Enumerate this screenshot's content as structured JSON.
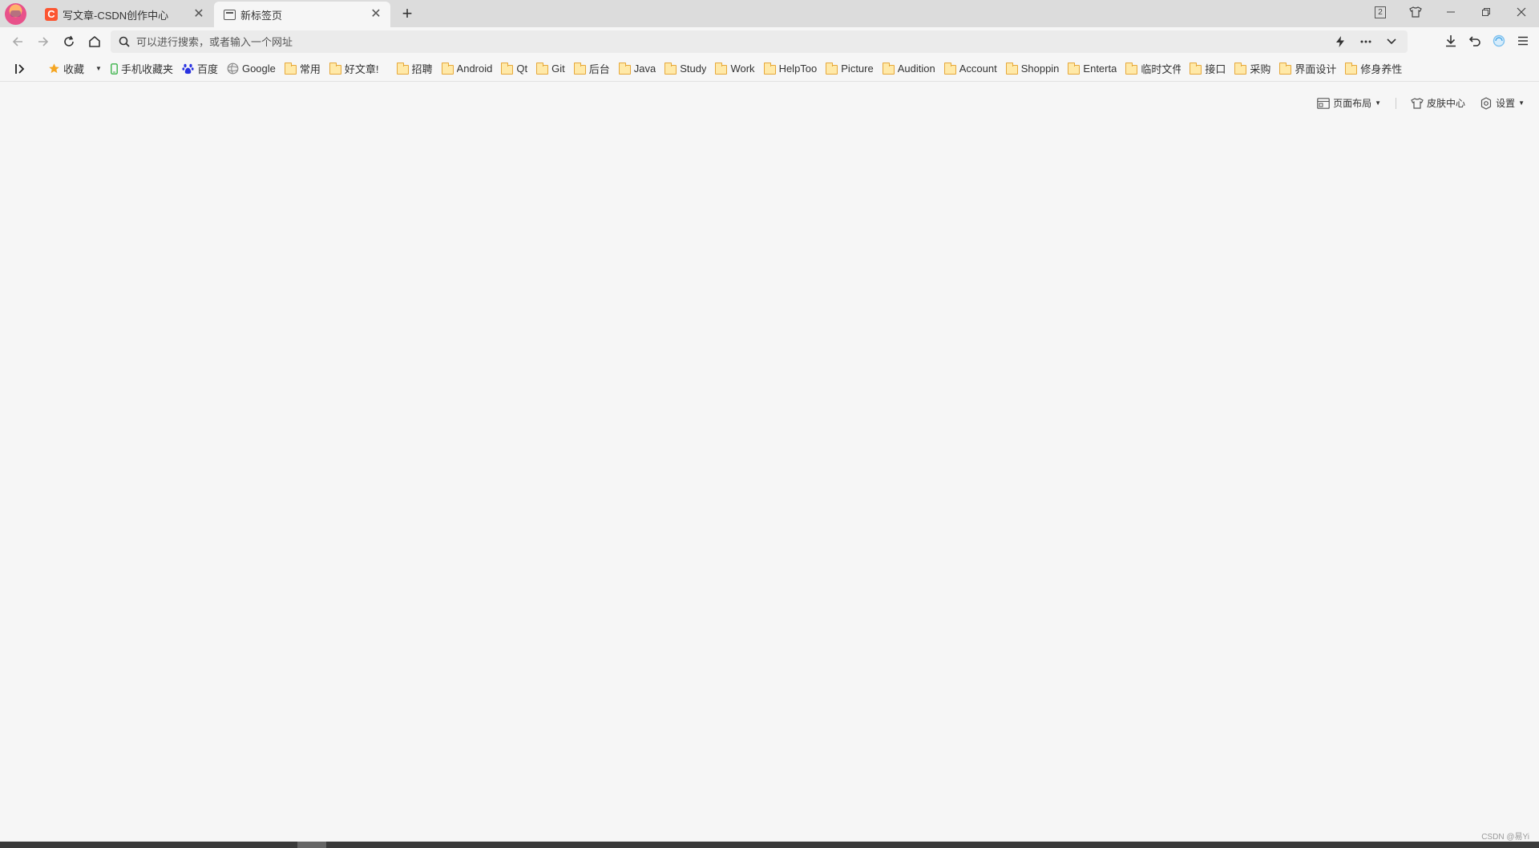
{
  "tabs": [
    {
      "title": "写文章-CSDN创作中心",
      "favicon": "csdn-favicon",
      "active": false
    },
    {
      "title": "新标签页",
      "favicon": "newtab-icon",
      "active": true
    }
  ],
  "titlebar": {
    "tab_count": "2"
  },
  "addressbar": {
    "placeholder": "可以进行搜索，或者输入一个网址"
  },
  "bookmarks": [
    {
      "label": "收藏",
      "icon": "star-icon"
    },
    {
      "label": "手机收藏夹",
      "icon": "phone-icon"
    },
    {
      "label": "百度",
      "icon": "baidu-paw-icon"
    },
    {
      "label": "Google",
      "icon": "globe-icon"
    },
    {
      "label": "常用",
      "icon": "folder-icon"
    },
    {
      "label": "好文章!",
      "icon": "folder-icon"
    },
    {
      "label": "招聘",
      "icon": "folder-icon"
    },
    {
      "label": "Android",
      "icon": "folder-icon"
    },
    {
      "label": "Qt",
      "icon": "folder-icon"
    },
    {
      "label": "Git",
      "icon": "folder-icon"
    },
    {
      "label": "后台",
      "icon": "folder-icon"
    },
    {
      "label": "Java",
      "icon": "folder-icon"
    },
    {
      "label": "Study",
      "icon": "folder-icon"
    },
    {
      "label": "Work",
      "icon": "folder-icon"
    },
    {
      "label": "HelpToo",
      "icon": "folder-icon"
    },
    {
      "label": "Picture",
      "icon": "folder-icon"
    },
    {
      "label": "Audition",
      "icon": "folder-icon"
    },
    {
      "label": "Account",
      "icon": "folder-icon"
    },
    {
      "label": "Shoppin",
      "icon": "folder-icon"
    },
    {
      "label": "Enterta",
      "icon": "folder-icon"
    },
    {
      "label": "临时文件",
      "icon": "folder-icon"
    },
    {
      "label": "接口",
      "icon": "folder-icon"
    },
    {
      "label": "采购",
      "icon": "folder-icon"
    },
    {
      "label": "界面设计",
      "icon": "folder-icon"
    },
    {
      "label": "修身养性",
      "icon": "folder-icon"
    }
  ],
  "page_controls": {
    "layout_label": "页面布局",
    "skin_label": "皮肤中心",
    "settings_label": "设置"
  },
  "watermark": "CSDN @易Yi",
  "colors": {
    "csdn_brand": "#fc5531",
    "folder": "#ffe9a8",
    "star": "#f5a623"
  }
}
